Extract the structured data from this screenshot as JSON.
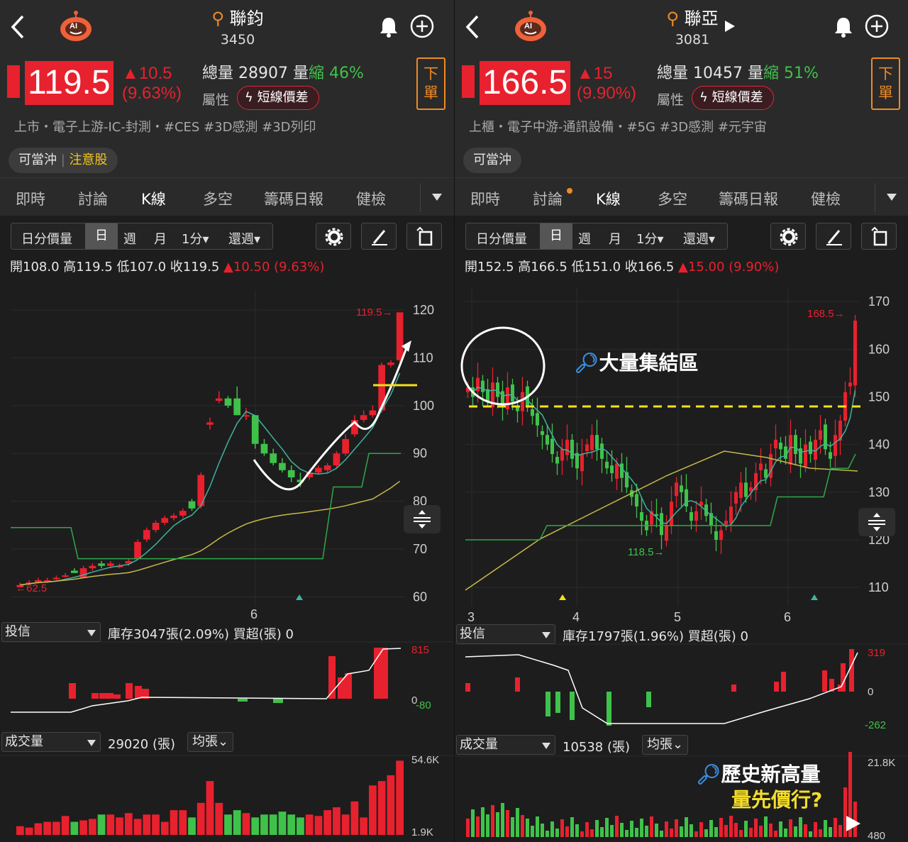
{
  "left": {
    "name": "聯鈞",
    "code": "3450",
    "price": "119.5",
    "change": "▲10.5",
    "change_pct": "(9.63%)",
    "volume_label": "總量",
    "volume": "28907",
    "vol_word": "量",
    "shrink": "縮",
    "shrink_pct": "46%",
    "attr_label": "屬性",
    "tag": "短線價差",
    "order_btn": [
      "下",
      "單"
    ],
    "category": "上市・電子上游-IC-封測・#CES  #3D感測  #3D列印",
    "badge1": "可當沖",
    "badge2": "注意股",
    "tabs": [
      "即時",
      "討論",
      "K線",
      "多空",
      "籌碼日報",
      "健檢"
    ],
    "ctrl": {
      "a": "日分價量",
      "b": "日",
      "c": "週",
      "d": "月",
      "e": "1分▾",
      "f": "還週▾"
    },
    "ohlc": "開108.0 高119.5 低107.0 收119.5",
    "ohlc_chg": "▲10.50 (9.63%)",
    "y_ticks": [
      "120",
      "110",
      "100",
      "90",
      "80",
      "70",
      "60"
    ],
    "x_tick": "6",
    "hi_label": "119.5→",
    "lo_label": "←62.5",
    "inst_select": "投信",
    "inst_info": "庫存3047張(2.09%)  買超(張) 0",
    "inst_axis": [
      "815",
      "0",
      "-80"
    ],
    "vol_select": "成交量",
    "vol_info": "29020 (張)",
    "avg_btn": "均張⌄",
    "vol_axis": [
      "54.6K",
      "1.9K"
    ],
    "chart_data": {
      "type": "candlestick",
      "y_range": [
        58,
        124
      ],
      "candles": [
        [
          62,
          63,
          62,
          62.5
        ],
        [
          63,
          63.5,
          62.5,
          63
        ],
        [
          63,
          64,
          62.8,
          63.5
        ],
        [
          63.5,
          64,
          63,
          63.5
        ],
        [
          64,
          64.5,
          63.5,
          64
        ],
        [
          64.5,
          65,
          64,
          64.5
        ],
        [
          65.5,
          66,
          65,
          65
        ],
        [
          64,
          66.5,
          64,
          66
        ],
        [
          66,
          67,
          65.5,
          66.5
        ],
        [
          67,
          67.5,
          66,
          66.5
        ],
        [
          66.5,
          67.5,
          66,
          67
        ],
        [
          66.5,
          67,
          66,
          66.5
        ],
        [
          67,
          68,
          66.5,
          67.5
        ],
        [
          68,
          72,
          68,
          71.5
        ],
        [
          72,
          74.5,
          71.5,
          74
        ],
        [
          74,
          76,
          73.5,
          75.5
        ],
        [
          75.5,
          77,
          75,
          76.5
        ],
        [
          76.5,
          77.5,
          76,
          77
        ],
        [
          77,
          78.5,
          76.5,
          78
        ],
        [
          80,
          80.5,
          78,
          78.5
        ],
        [
          79,
          86,
          78.5,
          85.5
        ],
        [
          96,
          97.5,
          95,
          96.5
        ],
        [
          101,
          103,
          100.5,
          101.5
        ],
        [
          101.5,
          102,
          99.5,
          100
        ],
        [
          101.5,
          104,
          98,
          98
        ],
        [
          98,
          99.5,
          97,
          98
        ],
        [
          98,
          98,
          91,
          92
        ],
        [
          92,
          93,
          89.5,
          90
        ],
        [
          90,
          91,
          87.5,
          88
        ],
        [
          88,
          89,
          86,
          86.5
        ],
        [
          86.5,
          87.5,
          84,
          85
        ],
        [
          84.5,
          86,
          83,
          84
        ],
        [
          85,
          86.5,
          84.5,
          86
        ],
        [
          86,
          87.5,
          85.5,
          87
        ],
        [
          86.5,
          88,
          86,
          87.5
        ],
        [
          87.5,
          90.5,
          87,
          90
        ],
        [
          90,
          94,
          89.5,
          93
        ],
        [
          94,
          98,
          93.5,
          97
        ],
        [
          97,
          99,
          96.5,
          98
        ],
        [
          98,
          100,
          97.5,
          99
        ],
        [
          99,
          109,
          98.5,
          108.5
        ],
        [
          108.5,
          109.5,
          108,
          109
        ],
        [
          109.5,
          119.5,
          109,
          119.5
        ]
      ],
      "inst_bars": [
        0,
        0,
        0,
        0,
        0,
        0,
        0,
        0,
        0,
        0,
        0,
        0,
        0,
        0,
        0,
        0,
        0,
        0,
        0,
        0,
        0,
        0,
        0,
        0,
        0,
        0,
        0,
        0,
        0,
        0,
        0,
        0,
        0,
        0,
        0,
        0,
        0,
        0,
        0,
        0,
        0,
        0,
        0,
        0,
        0,
        0,
        0,
        0,
        0,
        0,
        0,
        0,
        0,
        0,
        0,
        0,
        0,
        0,
        0,
        0
      ],
      "volumes": [
        6,
        5,
        8,
        9,
        9,
        13,
        9,
        10,
        11,
        14,
        14,
        12,
        15,
        11,
        14,
        14,
        9,
        17,
        17,
        12,
        22,
        37,
        22,
        14,
        17,
        15,
        12,
        14,
        14,
        16,
        14,
        12,
        14,
        13,
        17,
        19,
        14,
        23,
        12,
        34,
        37,
        41,
        51
      ]
    }
  },
  "right": {
    "name": "聯亞",
    "code": "3081",
    "price": "166.5",
    "change": "▲15",
    "change_pct": "(9.90%)",
    "volume_label": "總量",
    "volume": "10457",
    "vol_word": "量",
    "shrink": "縮",
    "shrink_pct": "51%",
    "attr_label": "屬性",
    "tag": "短線價差",
    "order_btn": [
      "下",
      "單"
    ],
    "category": "上櫃・電子中游-通訊設備・#5G  #3D感測  #元宇宙",
    "badge1": "可當沖",
    "tabs": [
      "即時",
      "討論",
      "K線",
      "多空",
      "籌碼日報",
      "健檢"
    ],
    "ctrl": {
      "a": "日分價量",
      "b": "日",
      "c": "週",
      "d": "月",
      "e": "1分▾",
      "f": "還週▾"
    },
    "ohlc": "開152.5 高166.5 低151.0 收166.5",
    "ohlc_chg": "▲15.00 (9.90%)",
    "y_ticks": [
      "170",
      "160",
      "150",
      "140",
      "130",
      "120",
      "110"
    ],
    "x_ticks": [
      "3",
      "4",
      "5",
      "6"
    ],
    "hi_label": "168.5→",
    "lo_label": "118.5→",
    "annot_gather": "大量集結區",
    "annot_hist1": "歷史新高量",
    "annot_hist2": "量先價行?",
    "inst_select": "投信",
    "inst_info": "庫存1797張(1.96%)  買超(張) 0",
    "inst_axis": [
      "319",
      "0",
      "-262"
    ],
    "vol_select": "成交量",
    "vol_info": "10538 (張)",
    "avg_btn": "均張⌄",
    "vol_axis": [
      "21.8K",
      "480"
    ]
  }
}
